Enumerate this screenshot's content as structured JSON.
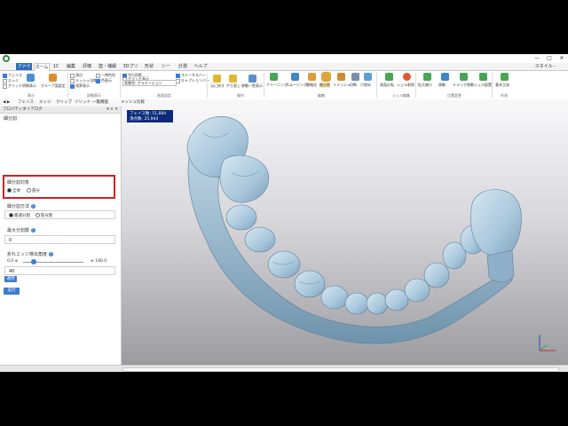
{
  "window": {
    "controls": [
      "—",
      "□",
      "✕"
    ]
  },
  "tabs": [
    {
      "label": "ファイル",
      "active": false
    },
    {
      "label": "ホーム",
      "active": true
    },
    {
      "label": "1C",
      "active": false
    },
    {
      "label": "編集",
      "active": false
    },
    {
      "label": "評価",
      "active": false
    },
    {
      "label": "歯・補綴",
      "active": false
    },
    {
      "label": "3Dプリント",
      "active": false
    },
    {
      "label": "形状",
      "active": false
    },
    {
      "label": "シーン",
      "active": false
    },
    {
      "label": "計測",
      "active": false
    },
    {
      "label": "ヘルプ",
      "active": false
    }
  ],
  "style_menu": "スタイル -",
  "ribbon": {
    "groups": [
      "表示",
      "詳細表示",
      "画面設定",
      "操作",
      "編集",
      "シェル編集",
      "位置変更",
      "作成"
    ],
    "show_checks": [
      {
        "label": "フェイス",
        "on": true
      },
      {
        "label": "エッジ",
        "on": false
      },
      {
        "label": "グリッド",
        "on": false
      }
    ],
    "show_buttons": [
      "明朝表示",
      "グループ面設定"
    ],
    "detail_checks": [
      {
        "label": "頂点",
        "on": false
      },
      {
        "label": "メッシュ法線",
        "on": false
      },
      {
        "label": "境界表示",
        "on": true
      },
      {
        "label": "一時色別",
        "on": false
      },
      {
        "label": "色表示",
        "on": true
      }
    ],
    "screen_checks": [
      {
        "label": "平行投影",
        "on": true
      },
      {
        "label": "グリッド表示",
        "on": false
      },
      {
        "label": "ステータスバー",
        "on": true
      },
      {
        "label": "キャプションバー",
        "on": false
      }
    ],
    "display_select": "背景色: グラデーション",
    "op_buttons": [
      "元に戻す",
      "やり直し",
      "移動一覧表示"
    ],
    "edit_buttons": [
      "クリーニング",
      "スムージング",
      "簡略化",
      "細分割",
      "リメッシュ",
      "切断",
      "穴埋め",
      "厚み"
    ],
    "shell_buttons": [
      "表面反転",
      "シェル削除"
    ],
    "pos_buttons": [
      "拡大縮小",
      "移動",
      "ドラッグ移動",
      "シェル配置"
    ],
    "create_buttons": [
      "基本立体"
    ]
  },
  "breadcrumb": [
    "フェイス",
    "エッジ",
    "クリップ",
    "ソリッド",
    "一覧機能",
    "メッシュ比較"
  ],
  "panel": {
    "header": "プロパティダイアログ",
    "controls": "▾ × ✕",
    "section_title": "細分割",
    "target_label": "細分割対象",
    "target_options": [
      {
        "label": "全体",
        "on": true
      },
      {
        "label": "部分",
        "on": false
      }
    ],
    "method_label": "細分割方法",
    "method_options": [
      {
        "label": "最適分割",
        "on": true
      },
      {
        "label": "等分割",
        "on": false
      }
    ],
    "max_label": "最大分割数",
    "max_value": "0",
    "angle_label": "折れエッジ検出角度",
    "angle_min": "0.0 ≤",
    "angle_max": "≤ 180.0",
    "angle_fraction": 0.17,
    "angle_value": "40",
    "apply_label": "適用",
    "run_label": "実行"
  },
  "viewport": {
    "face_label": "フェイス数:",
    "face_count": "51,884",
    "vertex_label": "頂点数:",
    "vertex_count": "25,944"
  },
  "colors": {
    "accent": "#3b7bd1",
    "highlight": "#d11f1f",
    "model": "#a9c7dc",
    "info_bg": "#0c2a7a"
  }
}
